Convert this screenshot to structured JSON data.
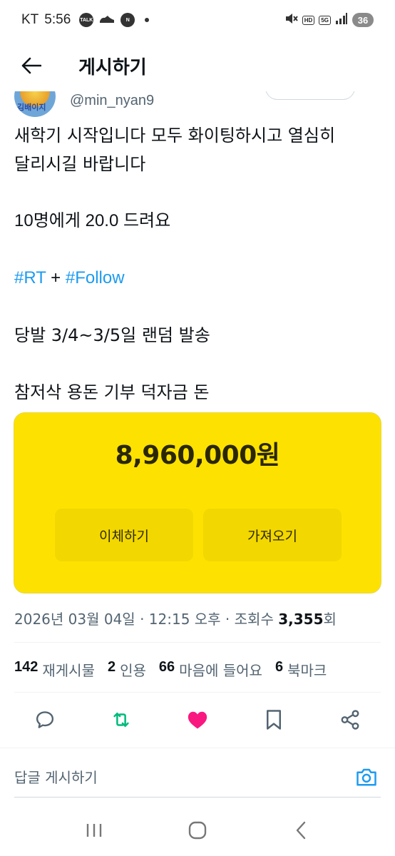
{
  "status_bar": {
    "carrier": "KT",
    "time": "5:56",
    "talk_label": "TALK",
    "n_label": "N",
    "hd_label": "HD",
    "network_label": "5G",
    "battery": "36"
  },
  "header": {
    "title": "게시하기"
  },
  "author": {
    "handle": "@min_nyan9",
    "avatar_text": "김배이지"
  },
  "tweet": {
    "line1": "새학기 시작입니다 모두 화이팅하시고 열심히",
    "line2": "달리시길 바랍니다",
    "line3": "10명에게 20.0 드려요",
    "hashtag1": "#RT",
    "plus": " + ",
    "hashtag2": "#Follow",
    "line5": "당발 3/4~3/5일 랜덤 발송",
    "line6": "참저삭 용돈 기부 덕자금 돈"
  },
  "media": {
    "amount": "8,960,000원",
    "transfer_label": "이체하기",
    "fetch_label": "가져오기",
    "bg_color": "#fde201"
  },
  "meta": {
    "datetime": "2026년 03월 04일 · 12:15 오후 · 조회수 ",
    "views": "3,355",
    "views_suffix": "회"
  },
  "stats": [
    {
      "num": "142",
      "label": "재게시물"
    },
    {
      "num": "2",
      "label": "인용"
    },
    {
      "num": "66",
      "label": "마음에 들어요"
    },
    {
      "num": "6",
      "label": "북마크"
    }
  ],
  "actions": {
    "reply_icon": "reply-icon",
    "retweet_icon": "retweet-icon",
    "like_icon": "heart-icon",
    "bookmark_icon": "bookmark-icon",
    "share_icon": "share-icon",
    "retweet_color": "#00ba7c",
    "like_color": "#f91880"
  },
  "reply": {
    "placeholder": "답글 게시하기",
    "accent": "#1d9bf0"
  }
}
